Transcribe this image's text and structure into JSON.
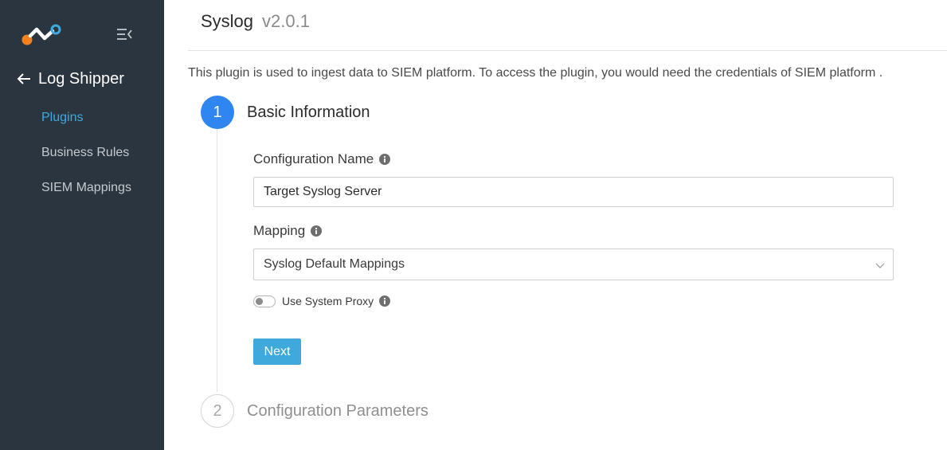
{
  "sidebar": {
    "logo_icon": "app-logo",
    "collapse_icon": "collapse-menu-icon",
    "back_icon": "arrow-left-icon",
    "section_title": "Log Shipper",
    "items": [
      {
        "label": "Plugins",
        "active": true
      },
      {
        "label": "Business Rules",
        "active": false
      },
      {
        "label": "SIEM Mappings",
        "active": false
      }
    ]
  },
  "header": {
    "title": "Syslog",
    "version": "v2.0.1"
  },
  "description": "This plugin is used to ingest data to SIEM platform. To access the plugin, you would need the credentials of SIEM platform .",
  "steps": [
    {
      "number": "1",
      "label": "Basic Information",
      "state": "active"
    },
    {
      "number": "2",
      "label": "Configuration Parameters",
      "state": "pending"
    }
  ],
  "form": {
    "config_name": {
      "label": "Configuration Name",
      "value": "Target Syslog Server"
    },
    "mapping": {
      "label": "Mapping",
      "value": "Syslog Default Mappings"
    },
    "proxy": {
      "label": "Use System Proxy",
      "enabled": false
    },
    "next_label": "Next"
  },
  "colors": {
    "sidebar_bg": "#2b353f",
    "accent": "#3fa9dc",
    "step_active": "#2f86f0"
  }
}
